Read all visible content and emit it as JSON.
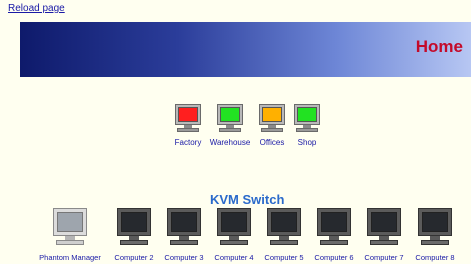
{
  "links": {
    "reload": "Reload page"
  },
  "banner": {
    "title": "Home"
  },
  "status_monitors": [
    {
      "label": "Factory",
      "color": "#ff1f1f",
      "icon": "monitor-icon"
    },
    {
      "label": "Warehouse",
      "color": "#22e222",
      "icon": "monitor-icon"
    },
    {
      "label": "Offices",
      "color": "#ffb000",
      "icon": "monitor-icon"
    },
    {
      "label": "Shop",
      "color": "#22e222",
      "icon": "monitor-icon"
    }
  ],
  "kvm": {
    "title": "KVM Switch",
    "computers": [
      {
        "label": "Phantom Manager",
        "style": "light",
        "icon": "monitor-icon"
      },
      {
        "label": "Computer 2",
        "style": "dark",
        "icon": "monitor-icon"
      },
      {
        "label": "Computer 3",
        "style": "dark",
        "icon": "monitor-icon"
      },
      {
        "label": "Computer 4",
        "style": "dark",
        "icon": "monitor-icon"
      },
      {
        "label": "Computer 5",
        "style": "dark",
        "icon": "monitor-icon"
      },
      {
        "label": "Computer 6",
        "style": "dark",
        "icon": "monitor-icon"
      },
      {
        "label": "Computer 7",
        "style": "dark",
        "icon": "monitor-icon"
      },
      {
        "label": "Computer 8",
        "style": "dark",
        "icon": "monitor-icon"
      }
    ]
  }
}
